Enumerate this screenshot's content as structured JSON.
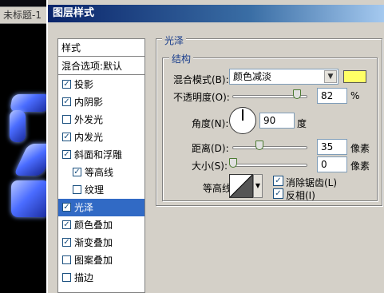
{
  "background_doc": {
    "tab_title": "未标题-1"
  },
  "dialog": {
    "title": "图层样式"
  },
  "style_list": {
    "header": "样式",
    "blend_options": "混合选项:默认",
    "items": [
      {
        "label": "投影",
        "checked": true
      },
      {
        "label": "内阴影",
        "checked": true
      },
      {
        "label": "外发光",
        "checked": false
      },
      {
        "label": "内发光",
        "checked": true
      },
      {
        "label": "斜面和浮雕",
        "checked": true
      },
      {
        "label": "等高线",
        "checked": true,
        "indent": true
      },
      {
        "label": "纹理",
        "checked": false,
        "indent": true
      },
      {
        "label": "光泽",
        "checked": true,
        "selected": true
      },
      {
        "label": "颜色叠加",
        "checked": true
      },
      {
        "label": "渐变叠加",
        "checked": true
      },
      {
        "label": "图案叠加",
        "checked": false
      },
      {
        "label": "描边",
        "checked": false
      }
    ]
  },
  "satin": {
    "section_title": "光泽",
    "structure_title": "结构",
    "blend_mode_label": "混合模式(B):",
    "blend_mode_value": "颜色减淡",
    "color_swatch": "#ffff66",
    "opacity_label": "不透明度(O):",
    "opacity_value": "82",
    "opacity_unit": "%",
    "angle_label": "角度(N):",
    "angle_value": "90",
    "angle_unit": "度",
    "distance_label": "距离(D):",
    "distance_value": "35",
    "distance_unit": "像素",
    "size_label": "大小(S):",
    "size_value": "0",
    "size_unit": "像素",
    "contour_label": "等高线:",
    "antialias_label": "消除锯齿(L)",
    "antialias_checked": true,
    "invert_label": "反相(I)",
    "invert_checked": true
  },
  "icons": {
    "check": "✓",
    "dropdown": "▼"
  },
  "colors": {
    "list_selection": "#316ac5",
    "title_bar": "#0a246a",
    "group_title": "#1a3e8c"
  }
}
